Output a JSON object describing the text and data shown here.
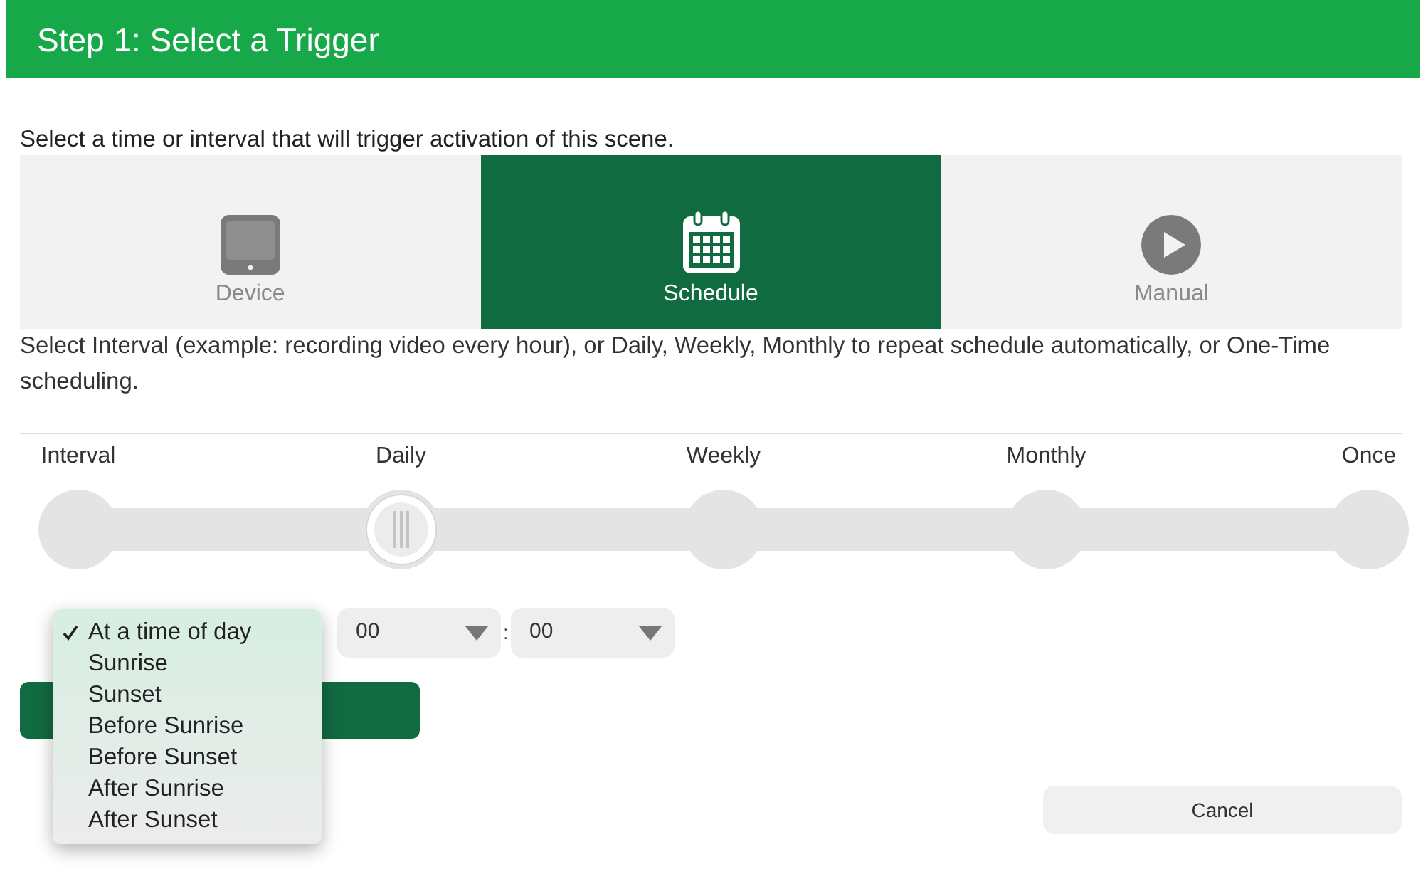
{
  "header": {
    "title": "Step 1: Select a Trigger"
  },
  "intro": "Select a time or interval that will trigger activation of this scene.",
  "trigger_tabs": [
    {
      "label": "Device",
      "kind": "device",
      "selected": false
    },
    {
      "label": "Schedule",
      "kind": "schedule",
      "selected": true
    },
    {
      "label": "Manual",
      "kind": "manual",
      "selected": false
    }
  ],
  "description": "Select Interval (example: recording video every hour), or Daily, Weekly, Monthly to repeat schedule automatically, or One-Time scheduling.",
  "schedule_slider": {
    "stops": [
      {
        "label": "Interval",
        "selected": false
      },
      {
        "label": "Daily",
        "selected": true
      },
      {
        "label": "Weekly",
        "selected": false
      },
      {
        "label": "Monthly",
        "selected": false
      },
      {
        "label": "Once",
        "selected": false
      }
    ]
  },
  "time": {
    "hour": "00",
    "separator": ":",
    "minute": "00"
  },
  "trigger_menu": {
    "items": [
      {
        "label": "At a time of day",
        "checked": true
      },
      {
        "label": "Sunrise",
        "checked": false
      },
      {
        "label": "Sunset",
        "checked": false
      },
      {
        "label": "Before Sunrise",
        "checked": false
      },
      {
        "label": "Before Sunset",
        "checked": false
      },
      {
        "label": "After Sunrise",
        "checked": false
      },
      {
        "label": "After Sunset",
        "checked": false
      }
    ]
  },
  "cancel_button": {
    "label": "Cancel"
  }
}
